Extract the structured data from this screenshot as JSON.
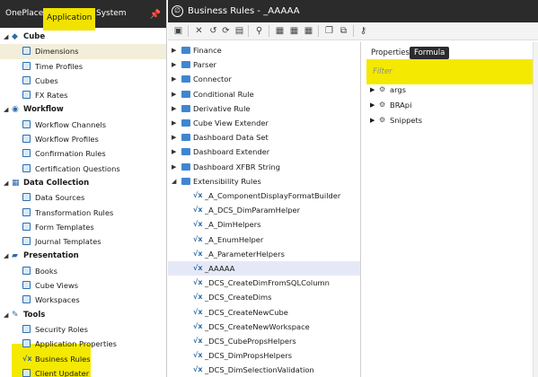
{
  "left": {
    "tabs": [
      "OnePlace",
      "Application",
      "System"
    ],
    "sections": [
      {
        "label": "Cube",
        "icon": "cube-icon",
        "items": [
          "Dimensions",
          "Time Profiles",
          "Cubes",
          "FX Rates"
        ]
      },
      {
        "label": "Workflow",
        "icon": "workflow-icon",
        "items": [
          "Workflow Channels",
          "Workflow Profiles",
          "Confirmation Rules",
          "Certification Questions"
        ]
      },
      {
        "label": "Data Collection",
        "icon": "data-collection-icon",
        "items": [
          "Data Sources",
          "Transformation Rules",
          "Form Templates",
          "Journal Templates"
        ]
      },
      {
        "label": "Presentation",
        "icon": "presentation-icon",
        "items": [
          "Books",
          "Cube Views",
          "Workspaces"
        ]
      },
      {
        "label": "Tools",
        "icon": "tools-icon",
        "items": [
          "Security Roles",
          "Application Properties",
          "Business Rules",
          "Client Updater"
        ]
      }
    ]
  },
  "main": {
    "title": "Business Rules - _AAAAA",
    "folders": [
      "Finance",
      "Parser",
      "Connector",
      "Conditional Rule",
      "Derivative Rule",
      "Cube View Extender",
      "Dashboard Data Set",
      "Dashboard Extender",
      "Dashboard XFBR String",
      "Extensibility Rules"
    ],
    "rules": [
      "_A_ComponentDisplayFormatBuilder",
      "_A_DCS_DimParamHelper",
      "_A_DimHelpers",
      "_A_EnumHelper",
      "_A_ParameterHelpers",
      "_AAAAA",
      "_DCS_CreateDimFromSQLColumn",
      "_DCS_CreateDims",
      "_DCS_CreateNewCube",
      "_DCS_CreateNewWorkspace",
      "_DCS_CubePropsHelpers",
      "_DCS_DimPropsHelpers",
      "_DCS_DimSelectionValidation"
    ],
    "selected_rule": "_AAAAA",
    "right_tabs": [
      "Properties",
      "Formula"
    ],
    "active_right_tab": "Formula",
    "filter_placeholder": "Filter",
    "formula_tree": [
      "args",
      "BRApi",
      "Snippets"
    ]
  },
  "colors": {
    "highlight": "#f4e900",
    "dark": "#2b2b2b",
    "selection": "#e5e9f7"
  }
}
